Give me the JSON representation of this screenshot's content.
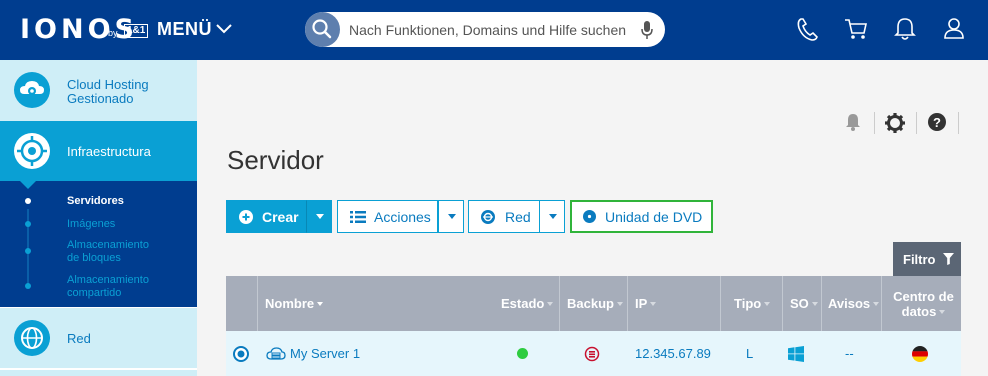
{
  "header": {
    "logo": "IONOS",
    "logo_by": "by",
    "logo_partner": "1&1",
    "menu_label": "MENÜ",
    "search_placeholder": "Nach Funktionen, Domains und Hilfe suchen",
    "icons": [
      "search-icon",
      "microphone-icon",
      "phone-icon",
      "cart-icon",
      "bell-icon",
      "user-icon"
    ]
  },
  "sidebar": {
    "items": [
      {
        "label_line1": "Cloud Hosting",
        "label_line2": "Gestionado",
        "icon": "cloud-gear-icon"
      },
      {
        "label": "Infraestructura",
        "icon": "infrastructure-icon",
        "active": true
      },
      {
        "label": "Red",
        "icon": "network-globe-icon"
      }
    ],
    "subitems": [
      {
        "label": "Servidores",
        "active": true
      },
      {
        "label": "Imágenes"
      },
      {
        "label_line1": "Almacenamiento",
        "label_line2": "de bloques"
      },
      {
        "label_line1": "Almacenamiento",
        "label_line2": "compartido"
      }
    ]
  },
  "main": {
    "title": "Servidor",
    "toolbar_icons": [
      "bell-icon",
      "gear-icon",
      "help-icon"
    ],
    "buttons": {
      "crear": "Crear",
      "acciones": "Acciones",
      "red": "Red",
      "dvd": "Unidad de DVD"
    },
    "filter_label": "Filtro",
    "table": {
      "columns": [
        "Nombre",
        "Estado",
        "Backup",
        "IP",
        "Tipo",
        "SO",
        "Avisos",
        "Centro de datos"
      ],
      "columns_datacenter_line1": "Centro de",
      "columns_datacenter_line2": "datos",
      "rows": [
        {
          "name": "My Server 1",
          "estado": "running",
          "backup": "backup-icon",
          "ip": "12.345.67.89",
          "tipo": "L",
          "so": "windows-icon",
          "avisos": "--",
          "datacenter": "germany-flag-icon"
        }
      ]
    }
  },
  "colors": {
    "brand": "#003d8f",
    "accent": "#0aa0d4",
    "highlight": "#30b43a",
    "status_ok": "#2ecc40"
  }
}
